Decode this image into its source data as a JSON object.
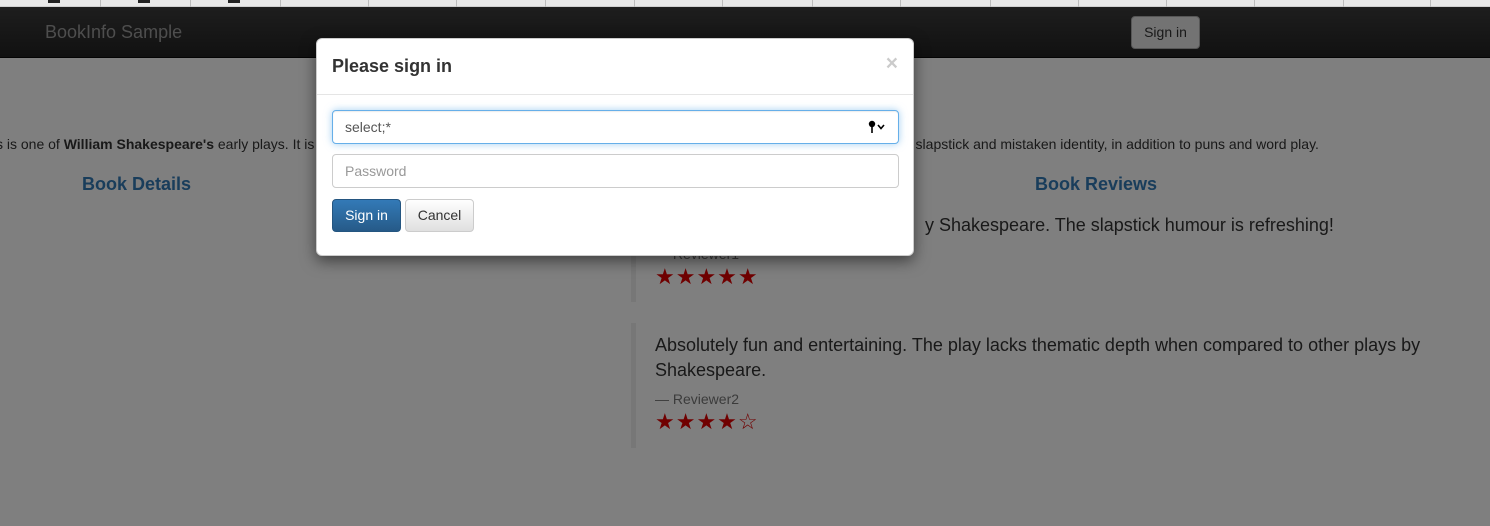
{
  "navbar": {
    "brand": "BookInfo Sample",
    "signin_label": "Sign in"
  },
  "product": {
    "summary_left_prefix": "s is one of ",
    "summary_author": "William Shakespeare's",
    "summary_left_suffix": " early plays. It is",
    "summary_right": "m slapstick and mistaken identity, in addition to puns and word play."
  },
  "details": {
    "title": "Book Details"
  },
  "reviews": {
    "title": "Book Reviews",
    "items": [
      {
        "text": "y Shakespeare. The slapstick humour is refreshing!",
        "author": "— Reviewer1",
        "stars": "★★★★★",
        "rating": 5
      },
      {
        "text": "Absolutely fun and entertaining. The play lacks thematic depth when compared to other plays by Shakespeare.",
        "author": "— Reviewer2",
        "stars": "★★★★☆",
        "rating": 4
      }
    ],
    "star_color": "#e00000"
  },
  "modal": {
    "title": "Please sign in",
    "close_glyph": "×",
    "username_value": "select;*",
    "password_placeholder": "Password",
    "submit_label": "Sign in",
    "cancel_label": "Cancel",
    "icons": [
      "close-icon",
      "key-icon",
      "chevron-down-icon"
    ]
  },
  "colors": {
    "link": "#337ab7",
    "primary": "#286090",
    "navbar": "#222222"
  }
}
